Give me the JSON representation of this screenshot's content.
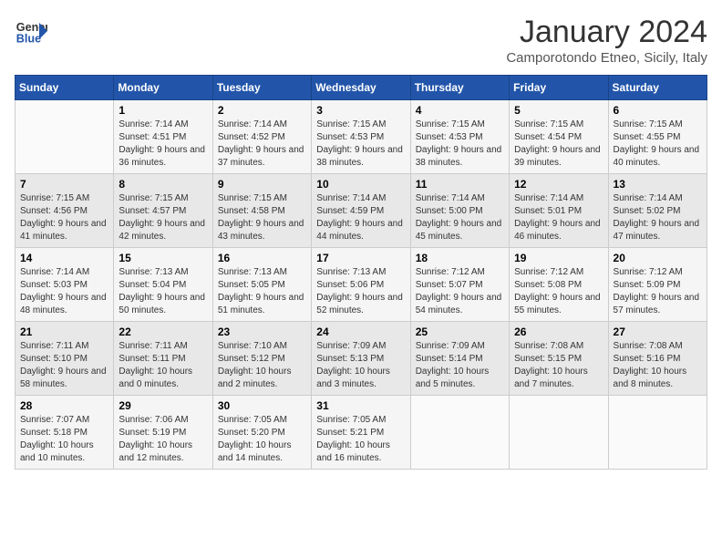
{
  "logo": {
    "line1": "General",
    "line2": "Blue"
  },
  "title": "January 2024",
  "subtitle": "Camporotondo Etneo, Sicily, Italy",
  "days_of_week": [
    "Sunday",
    "Monday",
    "Tuesday",
    "Wednesday",
    "Thursday",
    "Friday",
    "Saturday"
  ],
  "weeks": [
    [
      {
        "day": "",
        "sunrise": "",
        "sunset": "",
        "daylight": ""
      },
      {
        "day": "1",
        "sunrise": "Sunrise: 7:14 AM",
        "sunset": "Sunset: 4:51 PM",
        "daylight": "Daylight: 9 hours and 36 minutes."
      },
      {
        "day": "2",
        "sunrise": "Sunrise: 7:14 AM",
        "sunset": "Sunset: 4:52 PM",
        "daylight": "Daylight: 9 hours and 37 minutes."
      },
      {
        "day": "3",
        "sunrise": "Sunrise: 7:15 AM",
        "sunset": "Sunset: 4:53 PM",
        "daylight": "Daylight: 9 hours and 38 minutes."
      },
      {
        "day": "4",
        "sunrise": "Sunrise: 7:15 AM",
        "sunset": "Sunset: 4:53 PM",
        "daylight": "Daylight: 9 hours and 38 minutes."
      },
      {
        "day": "5",
        "sunrise": "Sunrise: 7:15 AM",
        "sunset": "Sunset: 4:54 PM",
        "daylight": "Daylight: 9 hours and 39 minutes."
      },
      {
        "day": "6",
        "sunrise": "Sunrise: 7:15 AM",
        "sunset": "Sunset: 4:55 PM",
        "daylight": "Daylight: 9 hours and 40 minutes."
      }
    ],
    [
      {
        "day": "7",
        "sunrise": "Sunrise: 7:15 AM",
        "sunset": "Sunset: 4:56 PM",
        "daylight": "Daylight: 9 hours and 41 minutes."
      },
      {
        "day": "8",
        "sunrise": "Sunrise: 7:15 AM",
        "sunset": "Sunset: 4:57 PM",
        "daylight": "Daylight: 9 hours and 42 minutes."
      },
      {
        "day": "9",
        "sunrise": "Sunrise: 7:15 AM",
        "sunset": "Sunset: 4:58 PM",
        "daylight": "Daylight: 9 hours and 43 minutes."
      },
      {
        "day": "10",
        "sunrise": "Sunrise: 7:14 AM",
        "sunset": "Sunset: 4:59 PM",
        "daylight": "Daylight: 9 hours and 44 minutes."
      },
      {
        "day": "11",
        "sunrise": "Sunrise: 7:14 AM",
        "sunset": "Sunset: 5:00 PM",
        "daylight": "Daylight: 9 hours and 45 minutes."
      },
      {
        "day": "12",
        "sunrise": "Sunrise: 7:14 AM",
        "sunset": "Sunset: 5:01 PM",
        "daylight": "Daylight: 9 hours and 46 minutes."
      },
      {
        "day": "13",
        "sunrise": "Sunrise: 7:14 AM",
        "sunset": "Sunset: 5:02 PM",
        "daylight": "Daylight: 9 hours and 47 minutes."
      }
    ],
    [
      {
        "day": "14",
        "sunrise": "Sunrise: 7:14 AM",
        "sunset": "Sunset: 5:03 PM",
        "daylight": "Daylight: 9 hours and 48 minutes."
      },
      {
        "day": "15",
        "sunrise": "Sunrise: 7:13 AM",
        "sunset": "Sunset: 5:04 PM",
        "daylight": "Daylight: 9 hours and 50 minutes."
      },
      {
        "day": "16",
        "sunrise": "Sunrise: 7:13 AM",
        "sunset": "Sunset: 5:05 PM",
        "daylight": "Daylight: 9 hours and 51 minutes."
      },
      {
        "day": "17",
        "sunrise": "Sunrise: 7:13 AM",
        "sunset": "Sunset: 5:06 PM",
        "daylight": "Daylight: 9 hours and 52 minutes."
      },
      {
        "day": "18",
        "sunrise": "Sunrise: 7:12 AM",
        "sunset": "Sunset: 5:07 PM",
        "daylight": "Daylight: 9 hours and 54 minutes."
      },
      {
        "day": "19",
        "sunrise": "Sunrise: 7:12 AM",
        "sunset": "Sunset: 5:08 PM",
        "daylight": "Daylight: 9 hours and 55 minutes."
      },
      {
        "day": "20",
        "sunrise": "Sunrise: 7:12 AM",
        "sunset": "Sunset: 5:09 PM",
        "daylight": "Daylight: 9 hours and 57 minutes."
      }
    ],
    [
      {
        "day": "21",
        "sunrise": "Sunrise: 7:11 AM",
        "sunset": "Sunset: 5:10 PM",
        "daylight": "Daylight: 9 hours and 58 minutes."
      },
      {
        "day": "22",
        "sunrise": "Sunrise: 7:11 AM",
        "sunset": "Sunset: 5:11 PM",
        "daylight": "Daylight: 10 hours and 0 minutes."
      },
      {
        "day": "23",
        "sunrise": "Sunrise: 7:10 AM",
        "sunset": "Sunset: 5:12 PM",
        "daylight": "Daylight: 10 hours and 2 minutes."
      },
      {
        "day": "24",
        "sunrise": "Sunrise: 7:09 AM",
        "sunset": "Sunset: 5:13 PM",
        "daylight": "Daylight: 10 hours and 3 minutes."
      },
      {
        "day": "25",
        "sunrise": "Sunrise: 7:09 AM",
        "sunset": "Sunset: 5:14 PM",
        "daylight": "Daylight: 10 hours and 5 minutes."
      },
      {
        "day": "26",
        "sunrise": "Sunrise: 7:08 AM",
        "sunset": "Sunset: 5:15 PM",
        "daylight": "Daylight: 10 hours and 7 minutes."
      },
      {
        "day": "27",
        "sunrise": "Sunrise: 7:08 AM",
        "sunset": "Sunset: 5:16 PM",
        "daylight": "Daylight: 10 hours and 8 minutes."
      }
    ],
    [
      {
        "day": "28",
        "sunrise": "Sunrise: 7:07 AM",
        "sunset": "Sunset: 5:18 PM",
        "daylight": "Daylight: 10 hours and 10 minutes."
      },
      {
        "day": "29",
        "sunrise": "Sunrise: 7:06 AM",
        "sunset": "Sunset: 5:19 PM",
        "daylight": "Daylight: 10 hours and 12 minutes."
      },
      {
        "day": "30",
        "sunrise": "Sunrise: 7:05 AM",
        "sunset": "Sunset: 5:20 PM",
        "daylight": "Daylight: 10 hours and 14 minutes."
      },
      {
        "day": "31",
        "sunrise": "Sunrise: 7:05 AM",
        "sunset": "Sunset: 5:21 PM",
        "daylight": "Daylight: 10 hours and 16 minutes."
      },
      {
        "day": "",
        "sunrise": "",
        "sunset": "",
        "daylight": ""
      },
      {
        "day": "",
        "sunrise": "",
        "sunset": "",
        "daylight": ""
      },
      {
        "day": "",
        "sunrise": "",
        "sunset": "",
        "daylight": ""
      }
    ]
  ]
}
